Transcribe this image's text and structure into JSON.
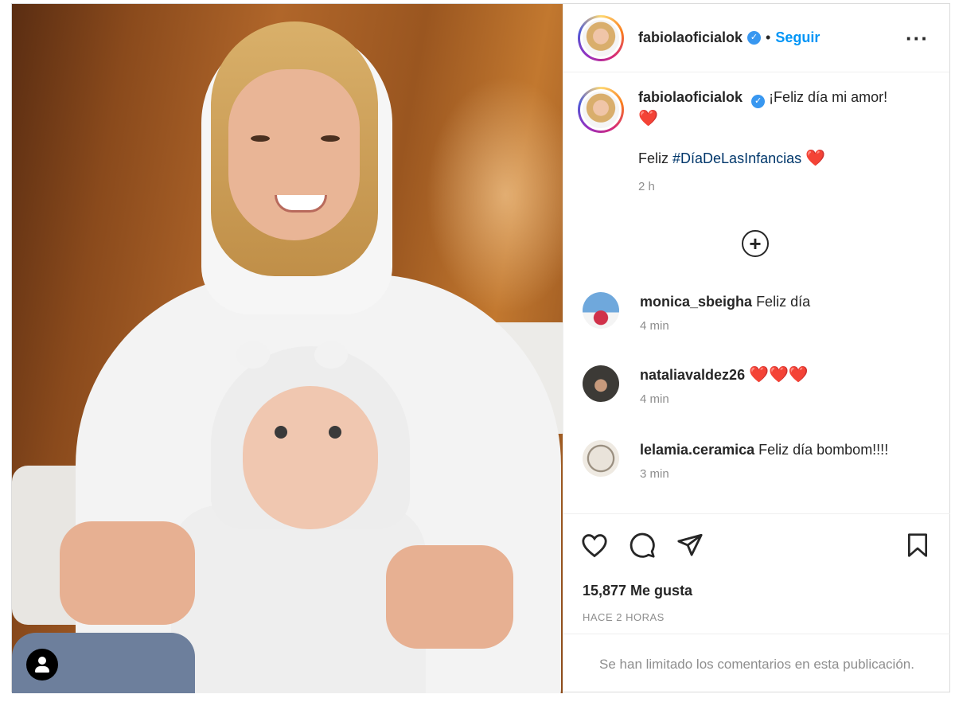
{
  "post": {
    "username": "fabiolaoficialok",
    "verified_icon": "verified-badge-icon",
    "follow_label": "Seguir",
    "separator": "•",
    "more_icon": "more-options-icon",
    "more_label": "···"
  },
  "caption": {
    "username": "fabiolaoficialok",
    "line1": "¡Feliz día mi amor!",
    "heart1": "❤️",
    "line2_prefix": "Feliz ",
    "hashtag": "#DíaDeLasInfancias",
    "heart2": "❤️",
    "time": "2 h"
  },
  "load_more_label": "+",
  "comments": [
    {
      "username": "monica_sbeigha",
      "text": "Feliz día",
      "time": "4 min"
    },
    {
      "username": "nataliavaldez26",
      "text": "❤️❤️❤️",
      "time": "4 min"
    },
    {
      "username": "lelamia.ceramica",
      "text": "Feliz día bombom!!!!",
      "time": "3 min"
    }
  ],
  "actions": {
    "like_icon": "heart-outline-icon",
    "comment_icon": "comment-bubble-icon",
    "share_icon": "paper-plane-icon",
    "save_icon": "bookmark-icon"
  },
  "likes": "15,877 Me gusta",
  "posted_ago": "HACE 2 HORAS",
  "comments_limited": "Se han limitado los comentarios en esta publicación.",
  "colors": {
    "follow": "#0095f6",
    "verified": "#3897f0",
    "heart": "#e0245e",
    "hashtag": "#00376b",
    "muted": "#8e8e8e"
  }
}
